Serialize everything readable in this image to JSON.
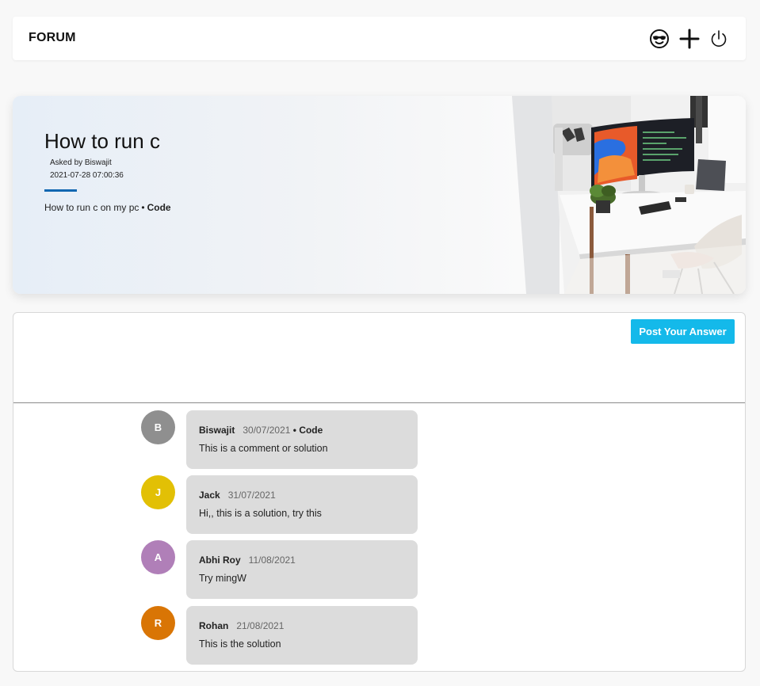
{
  "header": {
    "brand": "FORUM",
    "icons": [
      "sunglasses-face-icon",
      "plus-icon",
      "power-icon"
    ]
  },
  "question": {
    "title": "How to run c",
    "asked_by": "Asked by Biswajit",
    "datetime": "2021-07-28 07:00:36",
    "body": "How to run c on my pc",
    "separator": "•",
    "category": "Code",
    "accent": "#1167b1"
  },
  "answers_panel": {
    "post_button_label": "Post Your Answer",
    "post_button_color": "#14b9ea"
  },
  "answers": [
    {
      "initial": "B",
      "author": "Biswajit",
      "date": "30/07/2021",
      "separator": "•",
      "category": "Code",
      "text": "This is a comment or solution",
      "avatar_color": "#8f8f8f"
    },
    {
      "initial": "J",
      "author": "Jack",
      "date": "31/07/2021",
      "separator": "",
      "category": "",
      "text": "Hi,, this is a solution, try this",
      "avatar_color": "#e2c005"
    },
    {
      "initial": "A",
      "author": "Abhi Roy",
      "date": "11/08/2021",
      "separator": "",
      "category": "",
      "text": "Try mingW",
      "avatar_color": "#b07fb8"
    },
    {
      "initial": "R",
      "author": "Rohan",
      "date": "21/08/2021",
      "separator": "",
      "category": "",
      "text": "This is the solution",
      "avatar_color": "#d97505"
    }
  ]
}
